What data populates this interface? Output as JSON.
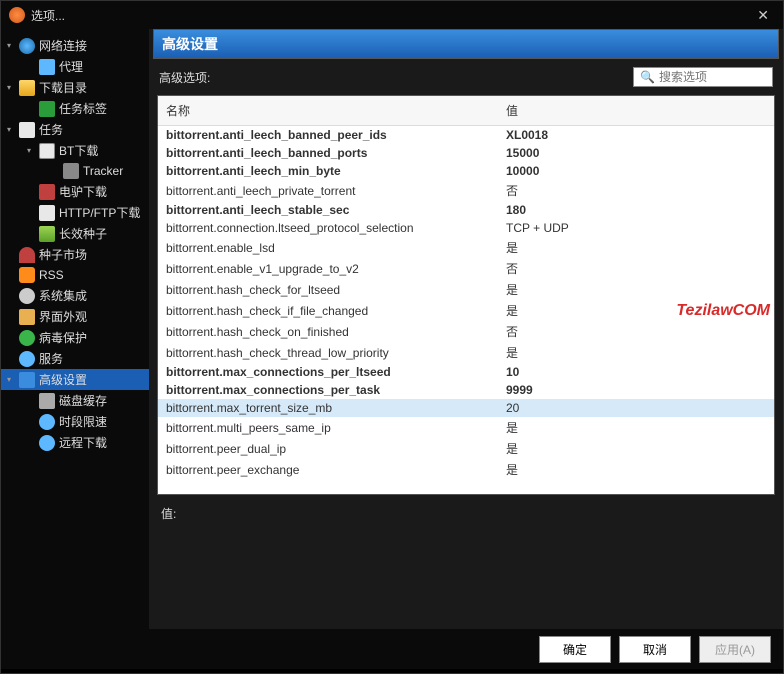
{
  "title": "选项...",
  "panel_heading": "高级设置",
  "search_label": "高级选项:",
  "search_placeholder": "搜索选项",
  "watermark": "TezilawCOM",
  "table": {
    "col_name": "名称",
    "col_value": "值",
    "rows": [
      {
        "name": "bittorrent.anti_leech_banned_peer_ids",
        "value": "XL0018",
        "bold": true
      },
      {
        "name": "bittorrent.anti_leech_banned_ports",
        "value": "15000",
        "bold": true
      },
      {
        "name": "bittorrent.anti_leech_min_byte",
        "value": "10000",
        "bold": true
      },
      {
        "name": "bittorrent.anti_leech_private_torrent",
        "value": "否",
        "bold": false
      },
      {
        "name": "bittorrent.anti_leech_stable_sec",
        "value": "180",
        "bold": true
      },
      {
        "name": "bittorrent.connection.ltseed_protocol_selection",
        "value": "TCP + UDP",
        "bold": false
      },
      {
        "name": "bittorrent.enable_lsd",
        "value": "是",
        "bold": false
      },
      {
        "name": "bittorrent.enable_v1_upgrade_to_v2",
        "value": "否",
        "bold": false
      },
      {
        "name": "bittorrent.hash_check_for_ltseed",
        "value": "是",
        "bold": false
      },
      {
        "name": "bittorrent.hash_check_if_file_changed",
        "value": "是",
        "bold": false
      },
      {
        "name": "bittorrent.hash_check_on_finished",
        "value": "否",
        "bold": false
      },
      {
        "name": "bittorrent.hash_check_thread_low_priority",
        "value": "是",
        "bold": false
      },
      {
        "name": "bittorrent.max_connections_per_ltseed",
        "value": "10",
        "bold": true
      },
      {
        "name": "bittorrent.max_connections_per_task",
        "value": "9999",
        "bold": true
      },
      {
        "name": "bittorrent.max_torrent_size_mb",
        "value": "20",
        "bold": false,
        "selected": true
      },
      {
        "name": "bittorrent.multi_peers_same_ip",
        "value": "是",
        "bold": false
      },
      {
        "name": "bittorrent.peer_dual_ip",
        "value": "是",
        "bold": false
      },
      {
        "name": "bittorrent.peer_exchange",
        "value": "是",
        "bold": false
      }
    ]
  },
  "value_label": "值:",
  "sidebar": [
    {
      "label": "网络连接",
      "icon": "globe",
      "level": 0,
      "toggle": "▾"
    },
    {
      "label": "代理",
      "icon": "proxy",
      "level": 1
    },
    {
      "label": "下载目录",
      "icon": "folder",
      "level": 0,
      "toggle": "▾"
    },
    {
      "label": "任务标签",
      "icon": "tag",
      "level": 1
    },
    {
      "label": "任务",
      "icon": "task",
      "level": 0,
      "toggle": "▾"
    },
    {
      "label": "BT下载",
      "icon": "bt",
      "level": 1,
      "toggle": "▾"
    },
    {
      "label": "Tracker",
      "icon": "tracker",
      "level": 2
    },
    {
      "label": "电驴下载",
      "icon": "donkey",
      "level": 1
    },
    {
      "label": "HTTP/FTP下载",
      "icon": "http",
      "level": 1
    },
    {
      "label": "长效种子",
      "icon": "longseed",
      "level": 1
    },
    {
      "label": "种子市场",
      "icon": "magnet",
      "level": 0
    },
    {
      "label": "RSS",
      "icon": "rss",
      "level": 0
    },
    {
      "label": "系统集成",
      "icon": "gear",
      "level": 0
    },
    {
      "label": "界面外观",
      "icon": "ui",
      "level": 0
    },
    {
      "label": "病毒保护",
      "icon": "shield",
      "level": 0
    },
    {
      "label": "服务",
      "icon": "service",
      "level": 0
    },
    {
      "label": "高级设置",
      "icon": "adv",
      "level": 0,
      "selected": true,
      "toggle": "▾"
    },
    {
      "label": "磁盘缓存",
      "icon": "disk",
      "level": 1
    },
    {
      "label": "时段限速",
      "icon": "clock",
      "level": 1
    },
    {
      "label": "远程下载",
      "icon": "remote",
      "level": 1
    }
  ],
  "buttons": {
    "ok": "确定",
    "cancel": "取消",
    "apply": "应用(A)"
  }
}
